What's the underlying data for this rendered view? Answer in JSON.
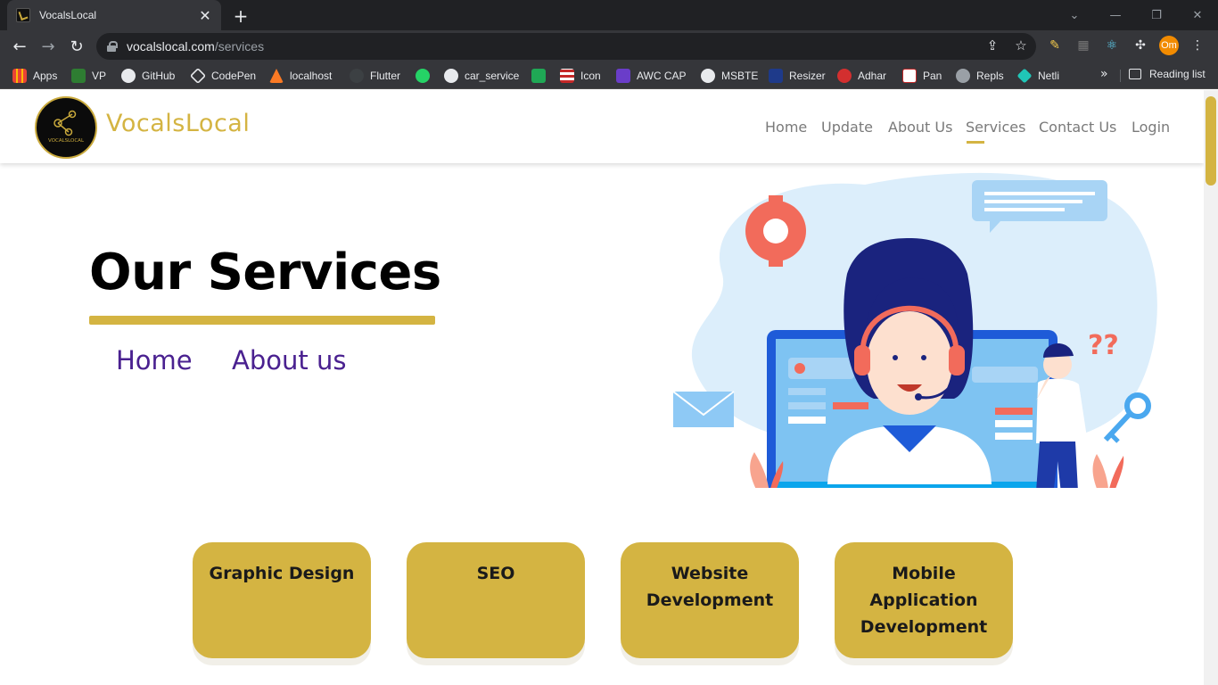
{
  "browser": {
    "tab_title": "VocalsLocal",
    "url_host": "vocalslocal.com",
    "url_path": "/services",
    "profile_initials": "Om",
    "bookmarks": [
      "Apps",
      "VP",
      "GitHub",
      "CodePen",
      "localhost",
      "Flutter",
      "car_service",
      "Icon",
      "AWC CAP",
      "MSBTE",
      "Resizer",
      "Adhar",
      "Pan",
      "Repls",
      "Netli"
    ],
    "reading_list": "Reading list",
    "more_bookmarks": "»"
  },
  "site": {
    "brand": "VocalsLocal",
    "logo_text": "VOCALSLOCAL",
    "nav": [
      "Home",
      "Update",
      "About Us",
      "Services",
      "Contact Us",
      "Login"
    ],
    "active_nav": "Services",
    "accent_color": "#d4b442",
    "link_color": "#4a2190"
  },
  "hero": {
    "title": "Our Services",
    "breadcrumbs": [
      "Home",
      "About us"
    ]
  },
  "services": [
    "Graphic Design",
    "SEO",
    "Website Development",
    "Mobile Application Development"
  ]
}
